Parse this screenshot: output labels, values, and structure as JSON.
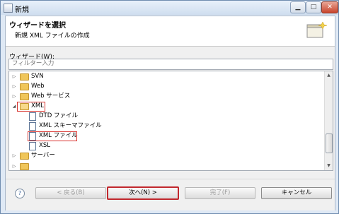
{
  "window": {
    "title": "新規"
  },
  "banner": {
    "title": "ウィザードを選択",
    "description": "新規 XML ファイルの作成",
    "icon": "wizard-banner-icon"
  },
  "wizards_label": "ウィザード(W):",
  "filter": {
    "placeholder": "フィルター入力",
    "value": ""
  },
  "tree": {
    "items": [
      {
        "label": "SVN",
        "kind": "folder",
        "expander": "collapsed"
      },
      {
        "label": "Web",
        "kind": "folder",
        "expander": "collapsed"
      },
      {
        "label": "Web サービス",
        "kind": "folder",
        "expander": "collapsed"
      },
      {
        "label": "XML",
        "kind": "folder",
        "expander": "expanded"
      },
      {
        "label": "DTD ファイル",
        "kind": "file"
      },
      {
        "label": "XML スキーマファイル",
        "kind": "file"
      },
      {
        "label": "XML ファイル",
        "kind": "file"
      },
      {
        "label": "XSL",
        "kind": "file"
      },
      {
        "label": "サーバー",
        "kind": "folder",
        "expander": "collapsed"
      }
    ]
  },
  "buttons": {
    "help": "?",
    "back": "< 戻る(B)",
    "next": "次へ(N) >",
    "finish": "完了(F)",
    "cancel": "キャンセル"
  },
  "colors": {
    "highlight": "#d9332e",
    "folder": "#f0c65a"
  }
}
